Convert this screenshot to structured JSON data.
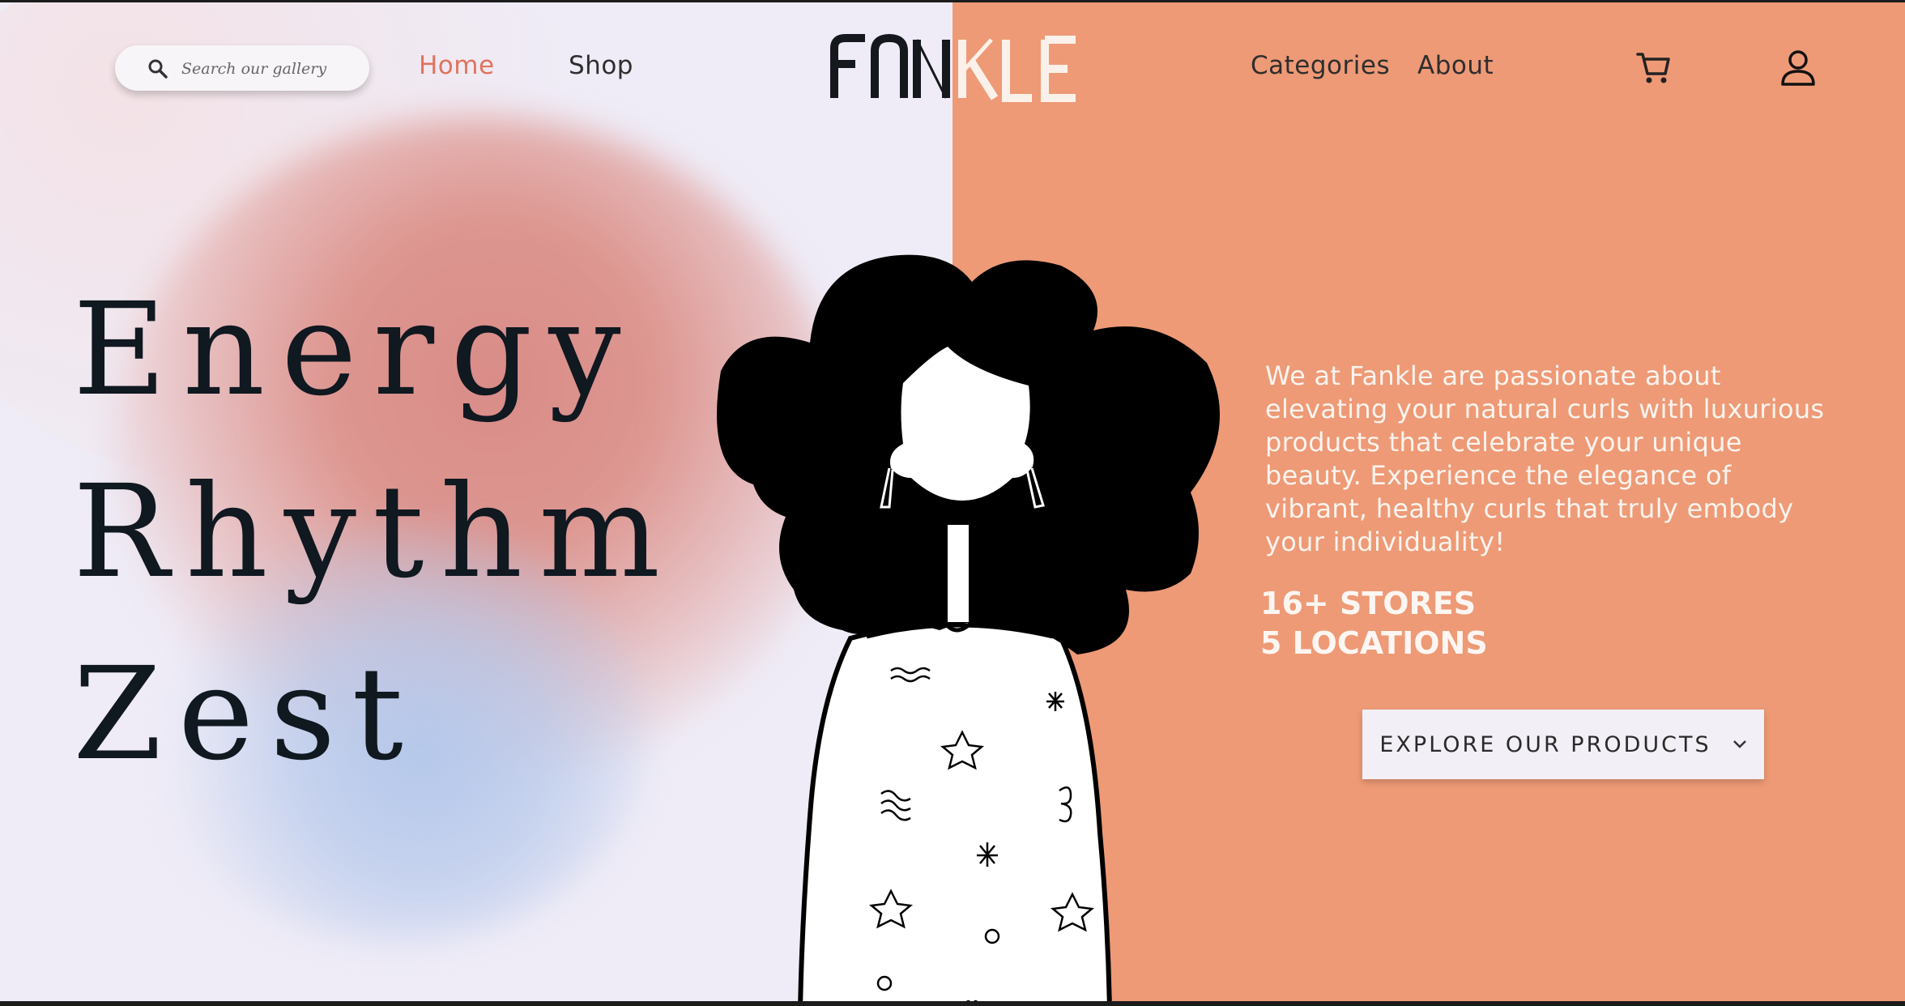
{
  "search": {
    "placeholder": "Search our gallery",
    "icon": "search-icon"
  },
  "nav": {
    "home": "Home",
    "shop": "Shop",
    "categories": "Categories",
    "about": "About"
  },
  "brand": {
    "logo_text": "FANKLE"
  },
  "header_icons": [
    "cart-icon",
    "user-icon"
  ],
  "hero": {
    "headline": [
      "Energy",
      "Rhythm",
      "Zest"
    ],
    "description": "We at Fankle are passionate about elevating your natural curls with luxurious products that celebrate your unique beauty. Experience the elegance of vibrant, healthy curls that truly embody your individuality!",
    "stats": [
      "16+ STORES",
      "5 LOCATIONS"
    ],
    "cta_label": "EXPLORE OUR PRODUCTS"
  },
  "colors": {
    "left_background": "#efecf7",
    "right_background": "#ee9a76",
    "accent_active_nav": "#e0735e",
    "headline_text": "#101820",
    "button_background": "#f2eff6"
  }
}
